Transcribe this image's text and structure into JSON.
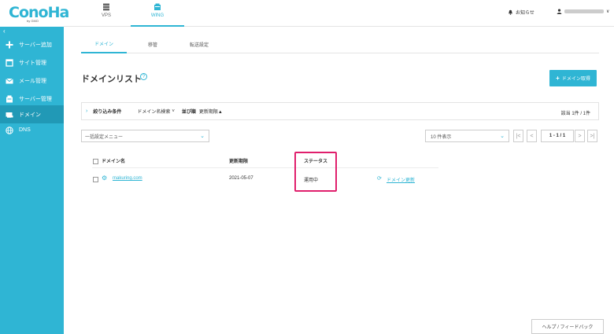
{
  "brand": {
    "logo": "ConoHa",
    "sub": "by GMO"
  },
  "header": {
    "tabs": [
      {
        "label": "VPS",
        "icon": "server-icon"
      },
      {
        "label": "WING",
        "icon": "server-stack-icon"
      }
    ],
    "notice": "お知らせ",
    "user_icon": "user-icon"
  },
  "sidebar": {
    "items": [
      {
        "label": "サーバー追加",
        "icon": "plus-icon"
      },
      {
        "label": "サイト管理",
        "icon": "window-icon"
      },
      {
        "label": "メール管理",
        "icon": "envelope-icon"
      },
      {
        "label": "サーバー管理",
        "icon": "server-icon"
      },
      {
        "label": "ドメイン",
        "icon": "domain-icon"
      },
      {
        "label": "DNS",
        "icon": "globe-icon"
      }
    ]
  },
  "subtabs": [
    "ドメイン",
    "移管",
    "転送設定"
  ],
  "page": {
    "title": "ドメインリスト",
    "help": "?",
    "primary_button": "ドメイン取得"
  },
  "filter": {
    "label": "絞り込み条件",
    "search": "ドメイン名検索",
    "sort_label": "並び順",
    "sort_value": "更新期限▲",
    "count": "該当 1件 / 1件"
  },
  "bulk_menu": {
    "value": "一括設定メニュー"
  },
  "per_page": {
    "value": "10 件表示"
  },
  "pager": {
    "first": "|<",
    "prev": "<",
    "info": "1 - 1 / 1",
    "next": ">",
    "last": ">|"
  },
  "table": {
    "headers": [
      "ドメイン名",
      "更新期限",
      "ステータス"
    ],
    "rows": [
      {
        "domain": "makuring.com",
        "expiry": "2021-05-07",
        "status": "運用中",
        "action": "ドメイン更新"
      }
    ]
  },
  "help_button": "ヘルプ / フィードバック",
  "colors": {
    "accent": "#2fb5d4",
    "sidebar_active": "#2199b6",
    "highlight": "#e01f6c"
  }
}
